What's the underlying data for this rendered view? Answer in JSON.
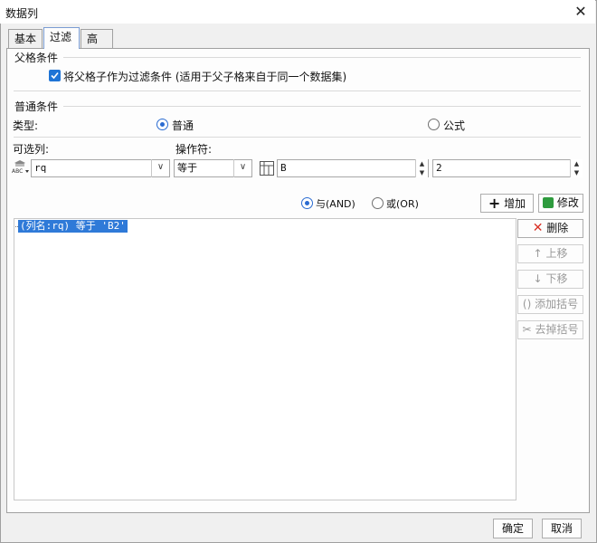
{
  "window": {
    "title": "数据列",
    "close_glyph": "✕"
  },
  "tabs": [
    {
      "label": "基本"
    },
    {
      "label": "过滤"
    },
    {
      "label": "高级"
    }
  ],
  "parent_condition": {
    "section_label": "父格条件",
    "checkbox_label": "将父格子作为过滤条件 (适用于父子格来自于同一个数据集)",
    "checked": true
  },
  "normal_condition": {
    "section_label": "普通条件",
    "type_label": "类型:",
    "type_options": [
      {
        "label": "普通",
        "selected": true
      },
      {
        "label": "公式",
        "selected": false
      }
    ],
    "column_label": "可选列:",
    "operator_label": "操作符:",
    "column_value": "rq",
    "operator_value": "等于",
    "cell_ref_value": "B",
    "row_value": "2"
  },
  "logic": {
    "and_label": "与(AND)",
    "or_label": "或(OR)",
    "selected": "and"
  },
  "actions": {
    "add_label": "增加",
    "modify_label": "修改",
    "delete_label": "删除",
    "move_up_label": "上移",
    "move_down_label": "下移",
    "add_bracket_label": "添加括号",
    "remove_bracket_label": "去掉括号"
  },
  "conditions": [
    {
      "text": "(列名:rq) 等于 'B2'",
      "selected": true
    }
  ],
  "footer": {
    "ok_label": "确定",
    "cancel_label": "取消"
  },
  "colors": {
    "accent": "#2f7ad8",
    "delete_red": "#d93025",
    "modify_green": "#2e9b3e"
  }
}
